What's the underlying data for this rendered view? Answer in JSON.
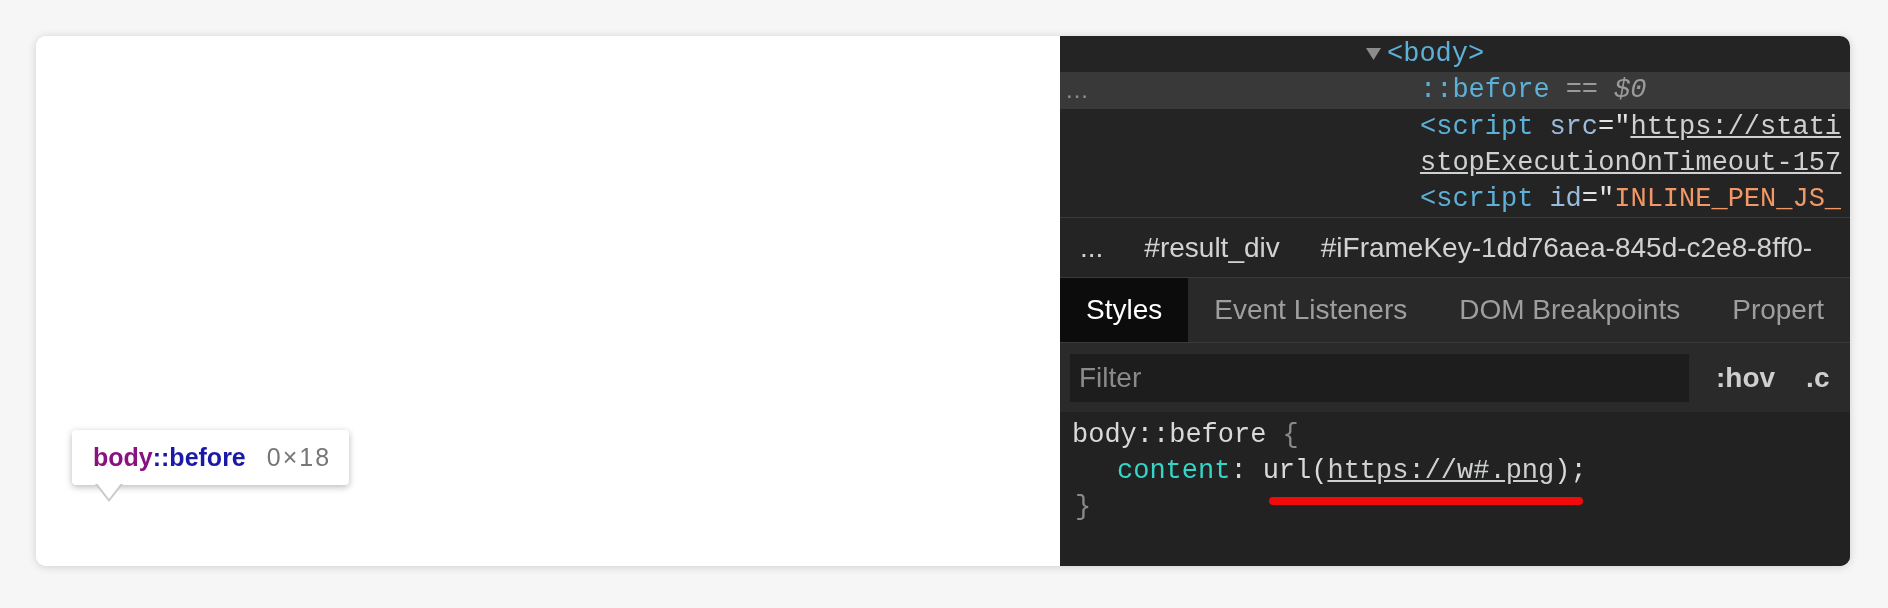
{
  "preview": {
    "tooltip": {
      "tag": "body",
      "pseudo": "::before",
      "size": "0×18"
    }
  },
  "devtools": {
    "dom_tree": [
      {
        "selected": false,
        "expanded": true,
        "lines": [
          [
            {
              "kind": "tag",
              "text": "<body>"
            }
          ]
        ],
        "children": [
          {
            "selected": true,
            "gutter": "...",
            "lines": [
              [
                {
                  "kind": "pseudo",
                  "text": "::before"
                },
                {
                  "kind": "marker",
                  "text": "=="
                },
                {
                  "kind": "console-var",
                  "text": "$0"
                }
              ]
            ]
          },
          {
            "selected": false,
            "lines": [
              [
                {
                  "kind": "tag",
                  "text": "<script"
                },
                {
                  "kind": "attr",
                  "text": "src"
                },
                {
                  "kind": "punct",
                  "text": "=\""
                },
                {
                  "kind": "link",
                  "text": "https://stati"
                }
              ],
              [
                {
                  "kind": "link",
                  "text": "stopExecutionOnTimeout-157"
                }
              ]
            ]
          },
          {
            "selected": false,
            "lines": [
              [
                {
                  "kind": "tag",
                  "text": "<script"
                },
                {
                  "kind": "attr",
                  "text": "id"
                },
                {
                  "kind": "punct",
                  "text": "=\""
                },
                {
                  "kind": "value",
                  "text": "INLINE_PEN_JS_"
                }
              ]
            ]
          }
        ]
      }
    ],
    "breadcrumbs": [
      "...",
      "#result_div",
      "#iFrameKey-1dd76aea-845d-c2e8-8ff0-"
    ],
    "tabs": [
      {
        "label": "Styles",
        "selected": true
      },
      {
        "label": "Event Listeners",
        "selected": false
      },
      {
        "label": "DOM Breakpoints",
        "selected": false
      },
      {
        "label": "Propert",
        "selected": false
      }
    ],
    "filter": {
      "placeholder": "Filter"
    },
    "toolbar_buttons": [
      {
        "label": ":hov"
      },
      {
        "label": ".c"
      }
    ],
    "styles": {
      "rules": [
        {
          "selector": "body::before",
          "open_brace": "{",
          "declarations": [
            {
              "property": "content",
              "separator": ":",
              "value": [
                {
                  "kind": "plain",
                  "text": "url("
                },
                {
                  "kind": "link",
                  "text": "https://w#.png"
                },
                {
                  "kind": "plain",
                  "text": ");"
                }
              ],
              "underlined": true
            }
          ],
          "close_brace": "}"
        }
      ]
    }
  }
}
